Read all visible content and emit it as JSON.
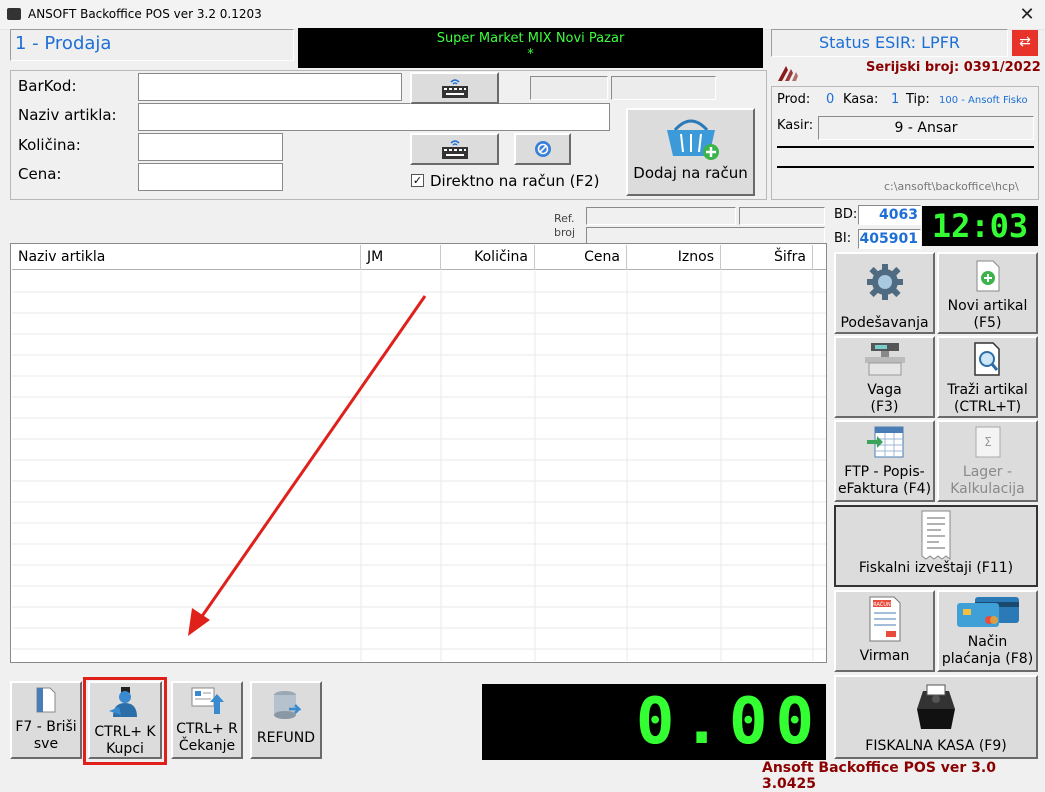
{
  "window": {
    "title": "ANSOFT Backoffice POS ver  3.2 0.1203",
    "close_glyph": "✕"
  },
  "header": {
    "mode": "1 - Prodaja",
    "market_name": "Super Market MIX Novi Pazar",
    "market_sub": "*",
    "status": "Status ESIR: LPFR",
    "serial": "Serijski broj: 0391/2022"
  },
  "form": {
    "barkod_label": "BarKod:",
    "naziv_label": "Naziv artikla:",
    "kolicina_label": "Količina:",
    "cena_label": "Cena:",
    "barkod_value": "",
    "naziv_value": "",
    "kolicina_value": "",
    "cena_value": "",
    "direktno_label": "Direktno na račun (F2)",
    "direktno_checked": true,
    "dodaj_label": "Dodaj na račun"
  },
  "info": {
    "prod_label": "Prod:",
    "prod_value": "0",
    "kasa_label": "Kasa:",
    "kasa_value": "1",
    "tip_label": "Tip:",
    "tip_value": "100 - Ansoft Fisko",
    "kasir_label": "Kasir:",
    "kasir_value": "9 - Ansar",
    "path": "c:\\ansoft\\backoffice\\hcp\\"
  },
  "ref": {
    "ref_label": "Ref.",
    "broj_label": "broj"
  },
  "counters": {
    "bd_label": "BD:",
    "bd_value": "4063",
    "bi_label": "BI:",
    "bi_value": "405901",
    "clock": "12:03"
  },
  "table": {
    "columns": [
      "Naziv artikla",
      "JM",
      "Količina",
      "Cena",
      "Iznos",
      "Šifra"
    ],
    "rows": []
  },
  "side_buttons": {
    "podesavanja": "Podešavanja",
    "novi_artikal": "Novi artikal",
    "novi_artikal_key": "(F5)",
    "vaga": "Vaga",
    "vaga_key": "(F3)",
    "trazi": "Traži artikal",
    "trazi_key": "(CTRL+T)",
    "ftp_1": "FTP - Popis-",
    "ftp_2": "eFaktura (F4)",
    "lager_1": "Lager -",
    "lager_2": "Kalkulacija",
    "fiskalni": "Fiskalni izveštaji (F11)",
    "virman": "Virman",
    "nacin_1": "Način",
    "nacin_2": "plaćanja (F8)",
    "fiskalna_kasa": "FISKALNA KASA (F9)",
    "racun_tag": "RAČUN"
  },
  "bottom_buttons": {
    "brisi_1": "F7 - Briši",
    "brisi_2": "sve",
    "kupci_1": "CTRL+ K",
    "kupci_2": "Kupci",
    "cekanje_1": "CTRL+ R",
    "cekanje_2": "Čekanje",
    "refund": "REFUND"
  },
  "total": "0.00",
  "footer": "Ansoft Backoffice POS ver 3.0 3.0425",
  "colors": {
    "accent_blue": "#1d6fd6",
    "display_green": "#33ff33",
    "highlight_red": "#e0211b",
    "serial_red": "#8b0000"
  }
}
